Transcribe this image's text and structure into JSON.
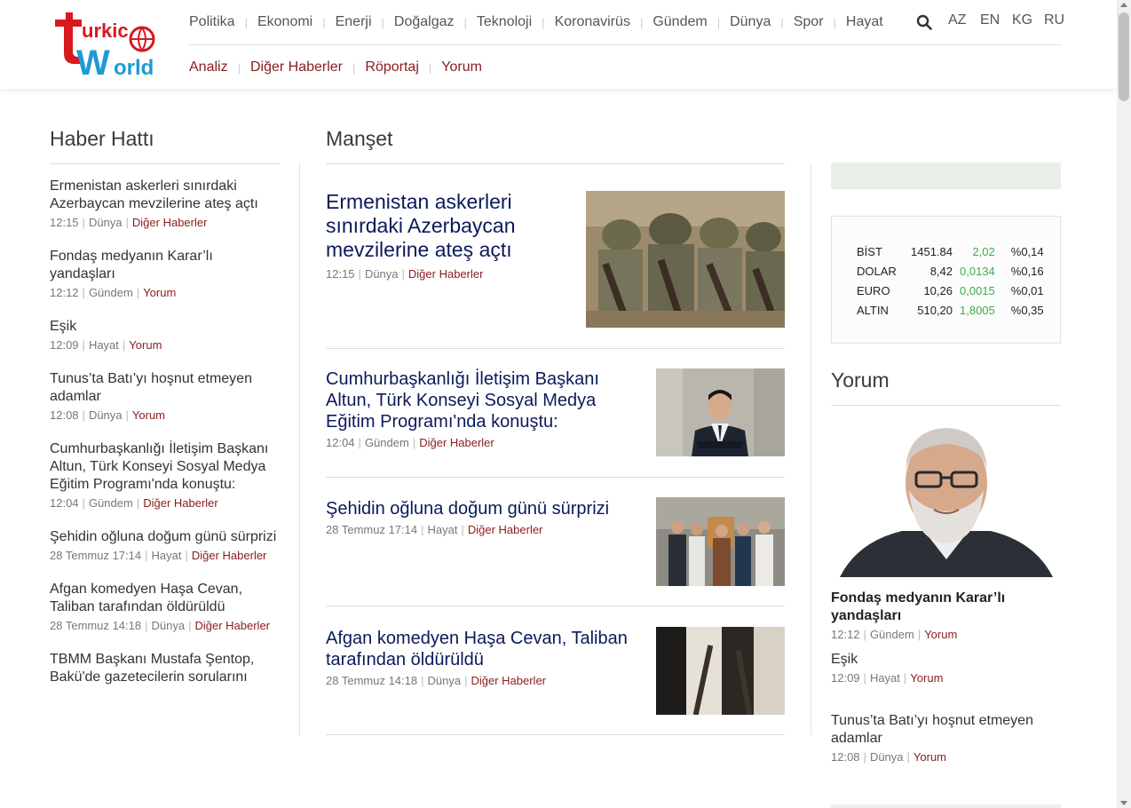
{
  "header": {
    "logo_alt": "turkic World",
    "nav_primary": [
      "Politika",
      "Ekonomi",
      "Enerji",
      "Doğalgaz",
      "Teknoloji",
      "Koronavirüs",
      "Gündem",
      "Dünya",
      "Spor",
      "Hayat"
    ],
    "nav_secondary": [
      "Analiz",
      "Diğer Haberler",
      "Röportaj",
      "Yorum"
    ],
    "languages": [
      "AZ",
      "EN",
      "KG",
      "RU"
    ]
  },
  "sections": {
    "left": "Haber Hattı",
    "main": "Manşet",
    "right": "Yorum"
  },
  "news_line": [
    {
      "title": "Ermenistan askerleri sınırdaki Azerbaycan mevzilerine ateş açtı",
      "time": "12:15",
      "region": "Dünya",
      "category": "Diğer Haberler"
    },
    {
      "title": "Fondaş medyanın Karar’lı yandaşları",
      "time": "12:12",
      "region": "Gündem",
      "category": "Yorum"
    },
    {
      "title": "Eşik",
      "time": "12:09",
      "region": "Hayat",
      "category": "Yorum"
    },
    {
      "title": "Tunus’ta Batı’yı hoşnut etmeyen adamlar",
      "time": "12:08",
      "region": "Dünya",
      "category": "Yorum"
    },
    {
      "title": "Cumhurbaşkanlığı İletişim Başkanı Altun, Türk Konseyi Sosyal Medya Eğitim Programı'nda konuştu:",
      "time": "12:04",
      "region": "Gündem",
      "category": "Diğer Haberler"
    },
    {
      "title": "Şehidin oğluna doğum günü sürprizi",
      "time": "28 Temmuz 17:14",
      "region": "Hayat",
      "category": "Diğer Haberler"
    },
    {
      "title": "Afgan komedyen Haşa Cevan, Taliban tarafından öldürüldü",
      "time": "28 Temmuz 14:18",
      "region": "Dünya",
      "category": "Diğer Haberler"
    },
    {
      "title": "TBMM Başkanı Mustafa Şentop, Bakü'de gazetecilerin sorularını",
      "time": "",
      "region": "",
      "category": ""
    }
  ],
  "headlines": [
    {
      "title": "Ermenistan askerleri sınırdaki Azerbaycan mevzilerine ateş açtı",
      "time": "12:15",
      "region": "Dünya",
      "category": "Diğer Haberler"
    },
    {
      "title": "Cumhurbaşkanlığı İletişim Başkanı Altun, Türk Konseyi Sosyal Medya Eğitim Programı'nda konuştu:",
      "time": "12:04",
      "region": "Gündem",
      "category": "Diğer Haberler"
    },
    {
      "title": "Şehidin oğluna doğum günü sürprizi",
      "time": "28 Temmuz 17:14",
      "region": "Hayat",
      "category": "Diğer Haberler"
    },
    {
      "title": "Afgan komedyen Haşa Cevan, Taliban tarafından öldürüldü",
      "time": "28 Temmuz 14:18",
      "region": "Dünya",
      "category": "Diğer Haberler"
    }
  ],
  "market": [
    {
      "name": "BİST",
      "value": "1451.84",
      "change": "2,02",
      "percent": "%0,14"
    },
    {
      "name": "DOLAR",
      "value": "8,42",
      "change": "0,0134",
      "percent": "%0,16"
    },
    {
      "name": "EURO",
      "value": "10,26",
      "change": "0,0015",
      "percent": "%0,01"
    },
    {
      "name": "ALTIN",
      "value": "510,20",
      "change": "1,8005",
      "percent": "%0,35"
    }
  ],
  "opinion": [
    {
      "title": "Fondaş medyanın Karar’lı yandaşları",
      "time": "12:12",
      "region": "Gündem",
      "category": "Yorum"
    },
    {
      "title": "Eşik",
      "time": "12:09",
      "region": "Hayat",
      "category": "Yorum"
    },
    {
      "title": "Tunus’ta Batı’yı hoşnut etmeyen adamlar",
      "time": "12:08",
      "region": "Dünya",
      "category": "Yorum"
    }
  ],
  "colors": {
    "accent": "#8b1c1c",
    "headline": "#0b1a5a",
    "logo_red": "#d71920",
    "logo_blue": "#1f9ad6",
    "market_up": "#3cae4a"
  }
}
